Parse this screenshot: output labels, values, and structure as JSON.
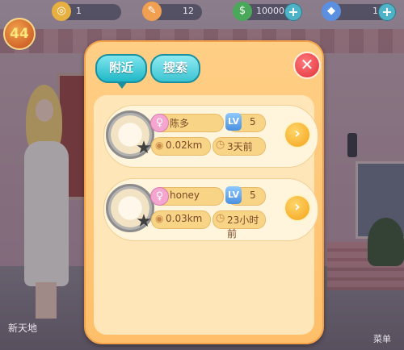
{
  "topbar": {
    "resources": [
      {
        "icon": "coin-icon",
        "value": "1"
      },
      {
        "icon": "hairbrush-icon",
        "value": "12"
      },
      {
        "icon": "cash-icon",
        "value": "10000"
      },
      {
        "icon": "diamond-icon",
        "value": "1"
      }
    ],
    "player_level": "44"
  },
  "side_labels": {
    "left": "新天地",
    "right": "菜单"
  },
  "dialog": {
    "tabs": [
      {
        "label": "附近",
        "active": true
      },
      {
        "label": "搜索",
        "active": false
      }
    ],
    "close_symbol": "✕",
    "players": [
      {
        "name": "陈多",
        "gender_icon": "female-icon",
        "level_tag": "LV",
        "level": "5",
        "distance": "0.02km",
        "last_seen": "3天前"
      },
      {
        "name": "honey",
        "gender_icon": "female-icon",
        "level_tag": "LV",
        "level": "5",
        "distance": "0.03km",
        "last_seen": "23小时前"
      }
    ]
  },
  "colors": {
    "tab_accent": "#1fb8c7",
    "dialog_bg": "#ffcf86",
    "close_red": "#e0303c",
    "go_orange": "#f4a21a"
  }
}
